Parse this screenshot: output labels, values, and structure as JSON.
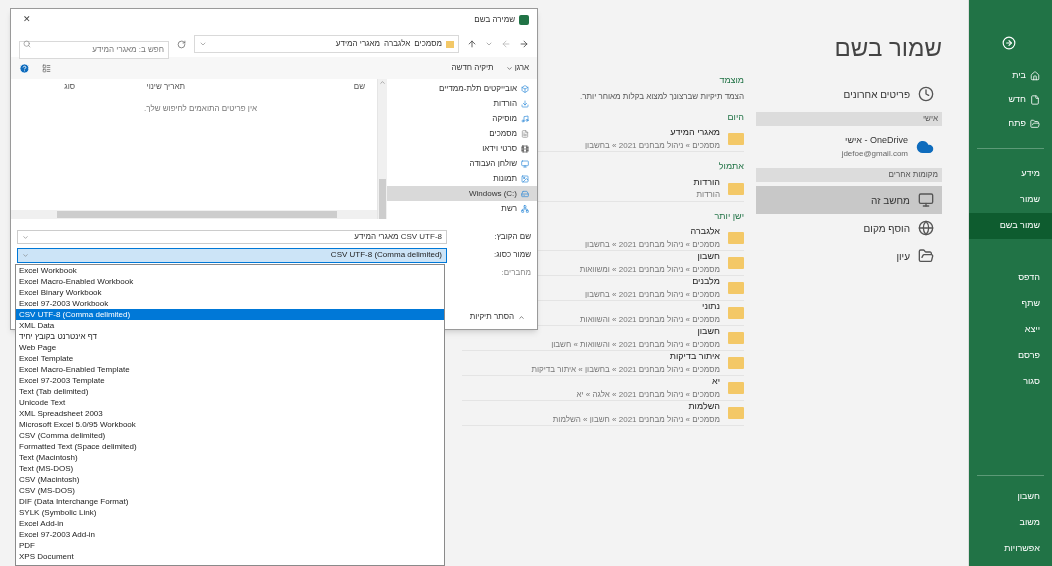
{
  "sidebar": {
    "top_items": [
      {
        "label": "בית",
        "selected": false
      },
      {
        "label": "חדש",
        "selected": false
      },
      {
        "label": "פתח",
        "selected": false
      }
    ],
    "items": [
      {
        "label": "מידע",
        "selected": false
      },
      {
        "label": "שמור",
        "selected": false
      },
      {
        "label": "שמור בשם",
        "selected": true
      },
      {
        "label": "הדפס",
        "selected": false
      },
      {
        "label": "שתף",
        "selected": false
      },
      {
        "label": "ייצא",
        "selected": false
      },
      {
        "label": "פרסם",
        "selected": false
      },
      {
        "label": "סגור",
        "selected": false
      }
    ],
    "bottom_items": [
      {
        "label": "חשבון",
        "selected": false
      },
      {
        "label": "משוב",
        "selected": false
      },
      {
        "label": "אפשרויות",
        "selected": false
      }
    ]
  },
  "locations": {
    "title": "שמור בשם",
    "entries": [
      {
        "kind": "item",
        "label": "פריטים אחרונים",
        "selected": false
      },
      {
        "kind": "header",
        "label": "אישי"
      },
      {
        "kind": "account",
        "label": "OneDrive - אישי",
        "detail": "jdefoe@gmail.com",
        "selected": false
      },
      {
        "kind": "header",
        "label": "מקומות אחרים"
      },
      {
        "kind": "item",
        "label": "מחשב זה",
        "selected": true
      },
      {
        "kind": "item",
        "label": "הוסף מקום",
        "selected": false
      },
      {
        "kind": "item",
        "label": "עיון",
        "selected": false
      }
    ]
  },
  "recent_folders": {
    "groups": [
      {
        "heading": "מוצמד",
        "note": "הצמד תיקיות שברצונך למצוא בקלות מאוחר יותר."
      },
      {
        "heading": "היום",
        "folders": [
          {
            "name": "מאגרי המידע",
            "path": "מסמכים » ניהול מבחנים 2021 » בחשבון"
          }
        ]
      },
      {
        "heading": "אתמול",
        "folders": [
          {
            "name": "הורדות",
            "path": "הורדות"
          }
        ]
      },
      {
        "heading": "ישן יותר",
        "folders": [
          {
            "name": "אלגברה",
            "path": "מסמכים » ניהול מבחנים 2021 » בחשבון"
          },
          {
            "name": "חשבון",
            "path": "מסמכים » ניהול מבחנים 2021 » ומשוואות"
          },
          {
            "name": "מלבנים",
            "path": "מסמכים » ניהול מבחנים 2021 » בחשבון"
          },
          {
            "name": "נתוני",
            "path": "מסמכים » ניהול מבחנים 2021 » והשוואות"
          },
          {
            "name": "חשבון",
            "path": "מסמכים » ניהול מבחנים 2021 » והשוואות » חשבון"
          },
          {
            "name": "איתור בדיקות",
            "path": "מסמכים » ניהול מבחנים 2021 » בחשבון » איתור בדיקות"
          },
          {
            "name": "יא",
            "path": "מסמכים » ניהול מבחנים 2021 » אלגה » יא"
          },
          {
            "name": "השלמות",
            "path": "מסמכים » ניהול מבחנים 2021 » חשבון » השלמות"
          }
        ]
      }
    ]
  },
  "dialog": {
    "title": "שמירה בשם",
    "close": "✕",
    "breadcrumb": [
      "מסמכים",
      "אלגברה",
      "מאגרי המידע"
    ],
    "search": {
      "placeholder": "חפש ב: מאגרי המידע"
    },
    "toolbar": {
      "organize": "ארגן",
      "new_folder": "תיקיה חדשה"
    },
    "nav": [
      {
        "label": "אובייקטים תלת-ממדיים",
        "selected": false
      },
      {
        "label": "הורדות",
        "selected": false
      },
      {
        "label": "מוסיקה",
        "selected": false
      },
      {
        "label": "מסמכים",
        "selected": false
      },
      {
        "label": "סרטי וידאו",
        "selected": false
      },
      {
        "label": "שולחן העבודה",
        "selected": false
      },
      {
        "label": "תמונות",
        "selected": false
      },
      {
        "label": "Windows (C:)",
        "selected": true
      },
      {
        "label": "רשת",
        "selected": false
      }
    ],
    "columns": [
      "שם",
      "תאריך שינוי",
      "סוג"
    ],
    "empty_message": "אין פריטים התואמים לחיפוש שלך.",
    "file_name": {
      "label": "שם הקובץ:",
      "value": "CSV UTF-8 מאגרי המידע"
    },
    "save_type": {
      "label": "שמור כסוג:",
      "value": "CSV UTF-8 (Comma delimited)",
      "expanded": true,
      "options": [
        {
          "label": "Excel Workbook",
          "selected": false
        },
        {
          "label": "Excel Macro-Enabled Workbook",
          "selected": false
        },
        {
          "label": "Excel Binary Workbook",
          "selected": false
        },
        {
          "label": "Excel 97-2003 Workbook",
          "selected": false
        },
        {
          "label": "CSV UTF-8 (Comma delimited)",
          "selected": true
        },
        {
          "label": "XML Data",
          "selected": false
        },
        {
          "label": "דף אינטרנט בקובץ יחיד",
          "selected": false
        },
        {
          "label": "Web Page",
          "selected": false
        },
        {
          "label": "Excel Template",
          "selected": false
        },
        {
          "label": "Excel Macro-Enabled Template",
          "selected": false
        },
        {
          "label": "Excel 97-2003 Template",
          "selected": false
        },
        {
          "label": "Text (Tab delimited)",
          "selected": false
        },
        {
          "label": "Unicode Text",
          "selected": false
        },
        {
          "label": "XML Spreadsheet 2003",
          "selected": false
        },
        {
          "label": "Microsoft Excel 5.0/95 Workbook",
          "selected": false
        },
        {
          "label": "CSV (Comma delimited)",
          "selected": false
        },
        {
          "label": "Formatted Text (Space delimited)",
          "selected": false
        },
        {
          "label": "Text (Macintosh)",
          "selected": false
        },
        {
          "label": "Text (MS-DOS)",
          "selected": false
        },
        {
          "label": "CSV (Macintosh)",
          "selected": false
        },
        {
          "label": "CSV (MS-DOS)",
          "selected": false
        },
        {
          "label": "DIF (Data Interchange Format)",
          "selected": false
        },
        {
          "label": "SYLK (Symbolic Link)",
          "selected": false
        },
        {
          "label": "Excel Add-in",
          "selected": false
        },
        {
          "label": "Excel 97-2003 Add-in",
          "selected": false
        },
        {
          "label": "PDF",
          "selected": false
        },
        {
          "label": "XPS Document",
          "selected": false
        }
      ]
    },
    "authors": {
      "label": "מחברים:"
    },
    "hide_folders": "הסתר תיקיות"
  }
}
